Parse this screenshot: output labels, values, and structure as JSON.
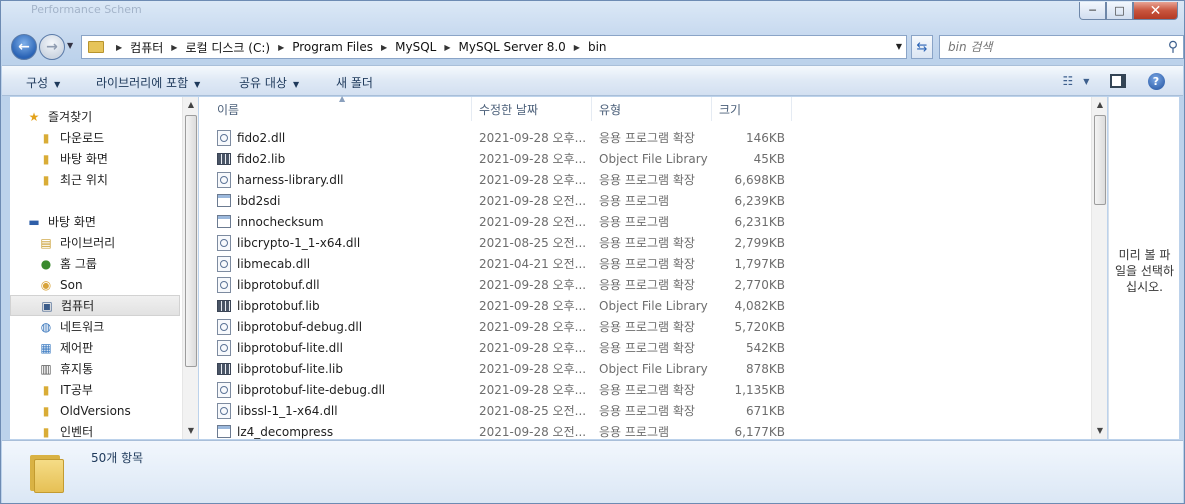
{
  "window": {
    "background_title": "Performance Schem",
    "controls": {
      "minimize": "─",
      "maximize": "□",
      "close": "✕"
    }
  },
  "address": {
    "breadcrumbs": [
      "컴퓨터",
      "로컬 디스크 (C:)",
      "Program Files",
      "MySQL",
      "MySQL Server 8.0",
      "bin"
    ],
    "search_placeholder": "bin 검색"
  },
  "toolbar": {
    "organize": "구성",
    "include_in_library": "라이브러리에 포함",
    "share_with": "공유 대상",
    "new_folder": "새 폴더"
  },
  "nav": {
    "favorites": "즐겨찾기",
    "favorites_items": [
      "다운로드",
      "바탕 화면",
      "최근 위치"
    ],
    "desktop": "바탕 화면",
    "desktop_items": [
      "라이브러리",
      "홈 그룹",
      "Son",
      "컴퓨터",
      "네트워크",
      "제어판",
      "휴지통",
      "IT공부",
      "OldVersions",
      "인벤터"
    ]
  },
  "columns": {
    "name": "이름",
    "date": "수정한 날짜",
    "type": "유형",
    "size": "크기"
  },
  "files": [
    {
      "name": "fido2.dll",
      "date": "2021-09-28 오후...",
      "type": "응용 프로그램 확장",
      "size": "146KB",
      "icon": "dll"
    },
    {
      "name": "fido2.lib",
      "date": "2021-09-28 오후...",
      "type": "Object File Library",
      "size": "45KB",
      "icon": "lib"
    },
    {
      "name": "harness-library.dll",
      "date": "2021-09-28 오후...",
      "type": "응용 프로그램 확장",
      "size": "6,698KB",
      "icon": "dll"
    },
    {
      "name": "ibd2sdi",
      "date": "2021-09-28 오전...",
      "type": "응용 프로그램",
      "size": "6,239KB",
      "icon": "exe"
    },
    {
      "name": "innochecksum",
      "date": "2021-09-28 오전...",
      "type": "응용 프로그램",
      "size": "6,231KB",
      "icon": "exe"
    },
    {
      "name": "libcrypto-1_1-x64.dll",
      "date": "2021-08-25 오전...",
      "type": "응용 프로그램 확장",
      "size": "2,799KB",
      "icon": "dll"
    },
    {
      "name": "libmecab.dll",
      "date": "2021-04-21 오전...",
      "type": "응용 프로그램 확장",
      "size": "1,797KB",
      "icon": "dll"
    },
    {
      "name": "libprotobuf.dll",
      "date": "2021-09-28 오후...",
      "type": "응용 프로그램 확장",
      "size": "2,770KB",
      "icon": "dll"
    },
    {
      "name": "libprotobuf.lib",
      "date": "2021-09-28 오후...",
      "type": "Object File Library",
      "size": "4,082KB",
      "icon": "lib"
    },
    {
      "name": "libprotobuf-debug.dll",
      "date": "2021-09-28 오후...",
      "type": "응용 프로그램 확장",
      "size": "5,720KB",
      "icon": "dll"
    },
    {
      "name": "libprotobuf-lite.dll",
      "date": "2021-09-28 오후...",
      "type": "응용 프로그램 확장",
      "size": "542KB",
      "icon": "dll"
    },
    {
      "name": "libprotobuf-lite.lib",
      "date": "2021-09-28 오후...",
      "type": "Object File Library",
      "size": "878KB",
      "icon": "lib"
    },
    {
      "name": "libprotobuf-lite-debug.dll",
      "date": "2021-09-28 오후...",
      "type": "응용 프로그램 확장",
      "size": "1,135KB",
      "icon": "dll"
    },
    {
      "name": "libssl-1_1-x64.dll",
      "date": "2021-08-25 오전...",
      "type": "응용 프로그램 확장",
      "size": "671KB",
      "icon": "dll"
    },
    {
      "name": "lz4_decompress",
      "date": "2021-09-28 오전...",
      "type": "응용 프로그램",
      "size": "6,177KB",
      "icon": "exe"
    }
  ],
  "preview": {
    "text_lines": [
      "미리 볼 파",
      "일을 선택하",
      "십시오."
    ]
  },
  "status": {
    "item_count": "50개 항목"
  }
}
